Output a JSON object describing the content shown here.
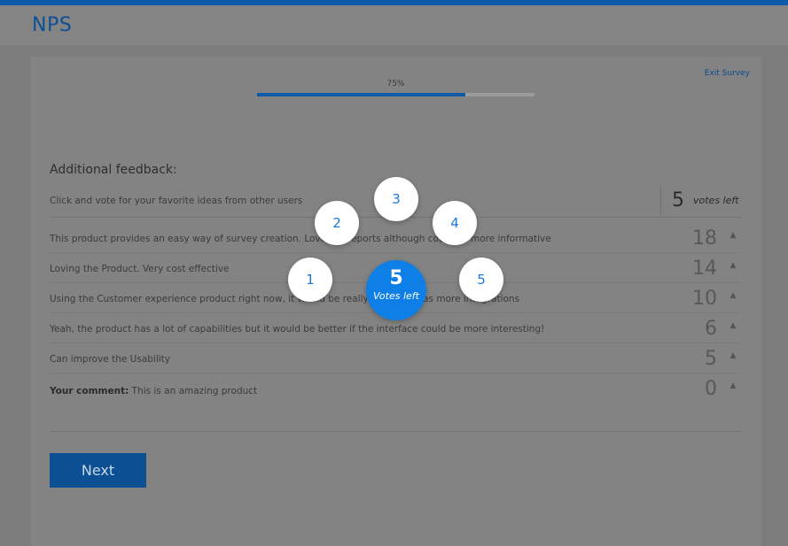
{
  "header": {
    "title": "NPS"
  },
  "survey": {
    "exit_label": "Exit Survey",
    "progress": {
      "label": "75%",
      "value": 0.75
    },
    "section_title": "Additional feedback:",
    "instruction": "Click and vote for your favorite ideas from other users",
    "votes_left": {
      "count": "5",
      "label": "votes left"
    },
    "ideas": [
      {
        "text": "This product provides an easy way of survey creation. Love the reports although could be more informative",
        "votes": "18"
      },
      {
        "text": "Loving the Product. Very cost effective",
        "votes": "14"
      },
      {
        "text": "Using the Customer experience product right now, it would be really great if it has more integrations",
        "votes": "10"
      },
      {
        "text": "Yeah, the product has a lot of capabilities but it would be better if the interface could be more interesting!",
        "votes": "6"
      },
      {
        "text": "Can improve the Usability",
        "votes": "5"
      }
    ],
    "your_comment": {
      "label": "Your comment:",
      "text": "This is an amazing product",
      "votes": "0"
    },
    "upvote_icon": "caret-up-icon",
    "next_label": "Next"
  },
  "vote_picker": {
    "options": [
      "1",
      "2",
      "3",
      "4",
      "5"
    ],
    "center": {
      "count": "5",
      "label": "Votes left"
    }
  },
  "colors": {
    "accent": "#0e5aa8",
    "bubble_blue": "#0d7fe6"
  }
}
